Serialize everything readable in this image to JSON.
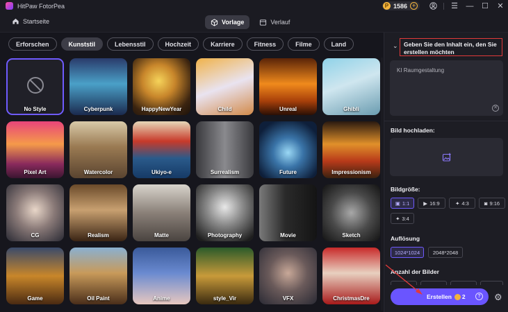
{
  "app": {
    "title": "HitPaw FotorPea",
    "coins": "1586"
  },
  "nav": {
    "home": "Startseite",
    "tabs": [
      "Vorlage",
      "Verlauf"
    ]
  },
  "categories": [
    "Erforschen",
    "Kunststil",
    "Lebensstil",
    "Hochzeit",
    "Karriere",
    "Fitness",
    "Filme",
    "Land"
  ],
  "tiles": [
    "No Style",
    "Cyberpunk",
    "HappyNewYear",
    "Child",
    "Unreal",
    "Ghibli",
    "Pixel Art",
    "Watercolor",
    "Ukiyo-e",
    "Surrealism",
    "Future",
    "Impressionism",
    "CG",
    "Realism",
    "Matte",
    "Photography",
    "Movie",
    "Sketch",
    "Game",
    "Oil Paint",
    "Anime",
    "style_Vir",
    "VFX",
    "ChristmasDre"
  ],
  "panel": {
    "prompt_title": "Geben Sie den Inhalt ein, den Sie erstellen möchten",
    "prompt_value": "KI Raumgestaltung",
    "upload_title": "Bild hochladen:",
    "size_title": "Bildgröße:",
    "sizes": [
      "1:1",
      "16:9",
      "4:3",
      "9:16",
      "3:4"
    ],
    "res_title": "Auflösung",
    "resolutions": [
      "1024*1024",
      "2048*2048"
    ],
    "count_title": "Anzahl der Bilder",
    "create_label": "Erstellen",
    "create_cost": "2"
  }
}
